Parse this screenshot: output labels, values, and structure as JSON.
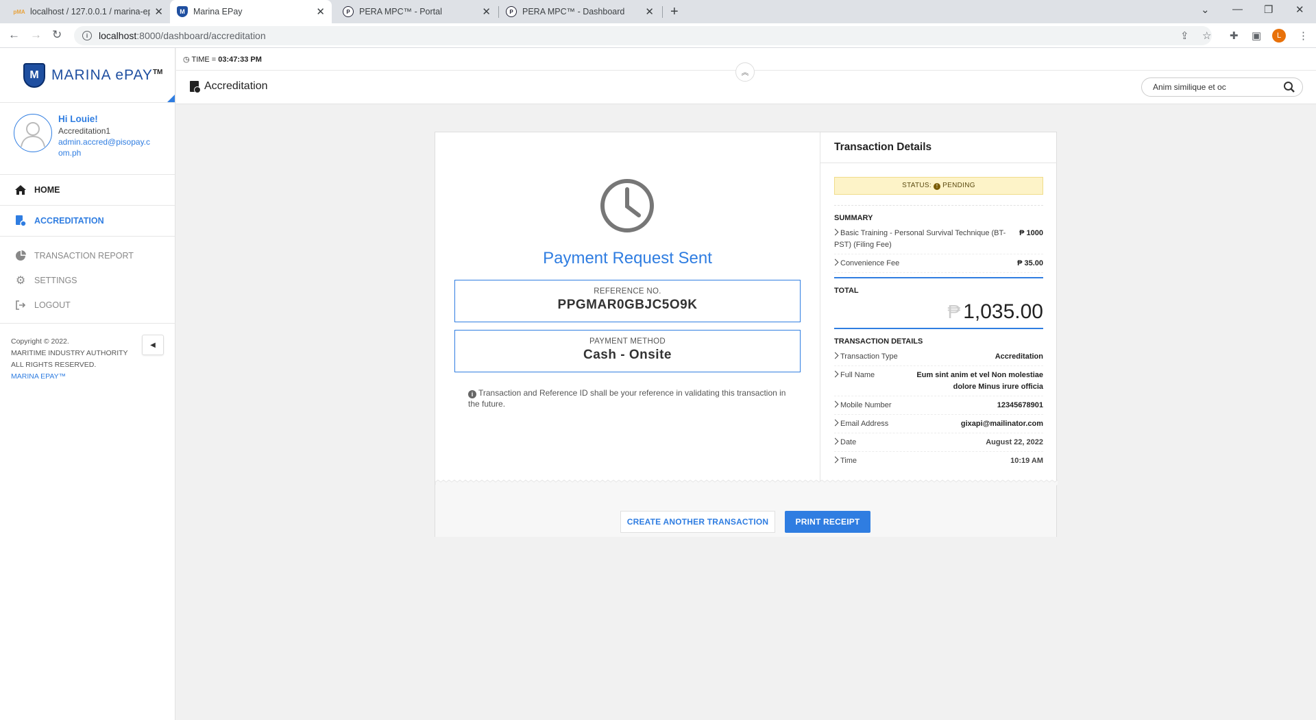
{
  "browser": {
    "tabs": [
      {
        "title": "localhost / 127.0.0.1 / marina-ep",
        "favicon": "phpmyadmin-icon"
      },
      {
        "title": "Marina EPay",
        "favicon": "marina-shield-icon"
      },
      {
        "title": "PERA MPC™ - Portal",
        "favicon": "pera-icon"
      },
      {
        "title": "PERA MPC™ - Dashboard",
        "favicon": "pera-icon"
      }
    ],
    "url_host": "localhost",
    "url_path": ":8000/dashboard/accreditation",
    "profile_initial": "L"
  },
  "sidebar": {
    "brand": "MARINA ePAY",
    "brand_tm": "TM",
    "user": {
      "greeting": "Hi Louie!",
      "role": "Accreditation1",
      "email": "admin.accred@pisopay.com.ph"
    },
    "nav": {
      "home": "HOME",
      "accreditation": "ACCREDITATION",
      "transaction_report": "TRANSACTION REPORT",
      "settings": "SETTINGS",
      "logout": "LOGOUT"
    },
    "copyright": {
      "line1": "Copyright © 2022.",
      "line2": "MARITIME INDUSTRY AUTHORITY",
      "line3": "ALL RIGHTS RESERVED.",
      "link": "MARINA EPAY™"
    }
  },
  "header": {
    "time_label": "TIME = ",
    "time_value": "03:47:33 PM",
    "page_title": "Accreditation",
    "search_value": "Anim similique et oc"
  },
  "receipt": {
    "title": "Payment Request Sent",
    "reference_label": "REFERENCE NO.",
    "reference_value": "PPGMAR0GBJC5O9K",
    "method_label": "PAYMENT METHOD",
    "method_value": "Cash - Onsite",
    "note": "Transaction and Reference ID shall be your reference in validating this transaction in the future."
  },
  "details": {
    "heading": "Transaction Details",
    "status_label": "STATUS:",
    "status_value": "PENDING",
    "summary_title": "SUMMARY",
    "summary": [
      {
        "label": "Basic Training - Personal Survival Technique (BT-PST) (Filing Fee)",
        "value": "₱ 1000"
      },
      {
        "label": "Convenience Fee",
        "value": "₱ 35.00"
      }
    ],
    "total_label": "TOTAL",
    "total_currency": "₱",
    "total_value": "1,035.00",
    "txn_title": "TRANSACTION DETAILS",
    "txn": [
      {
        "label": "Transaction Type",
        "value": "Accreditation"
      },
      {
        "label": "Full Name",
        "value": "Eum sint anim et vel Non molestiae dolore Minus irure officia"
      },
      {
        "label": "Mobile Number",
        "value": "12345678901"
      },
      {
        "label": "Email Address",
        "value": "gixapi@mailinator.com"
      },
      {
        "label": "Date",
        "value": "August 22, 2022"
      },
      {
        "label": "Time",
        "value": "10:19 AM"
      }
    ]
  },
  "actions": {
    "create_another": "CREATE ANOTHER TRANSACTION",
    "print_receipt": "PRINT RECEIPT"
  },
  "colors": {
    "accent": "#2f7de1",
    "brand": "#1f4fa0",
    "status_bg": "#fdf3c8"
  }
}
